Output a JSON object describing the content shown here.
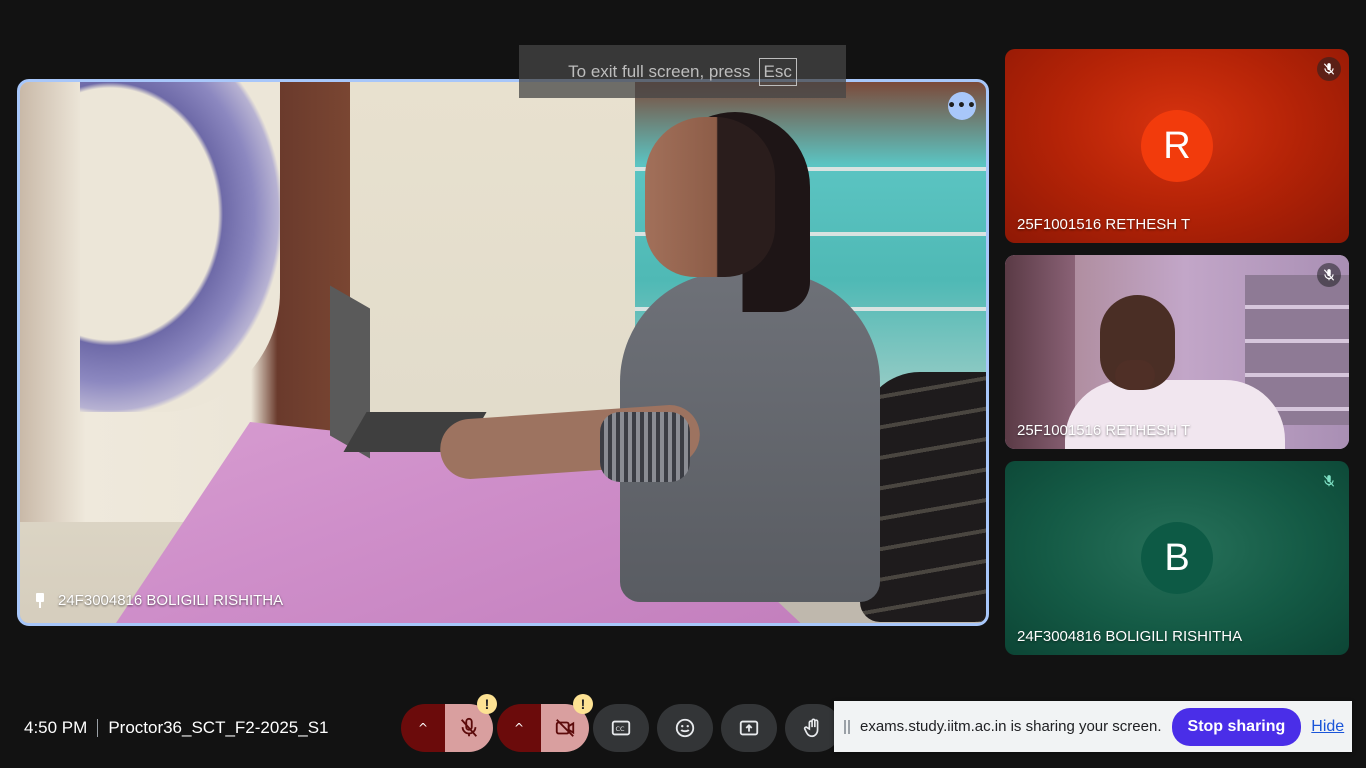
{
  "fullscreen_toast": {
    "text": "To exit full screen, press",
    "key": "Esc"
  },
  "main_tile": {
    "participant_name": "24F3004816 BOLIGILI RISHITHA",
    "pin_icon": "pin-icon",
    "more_icon": "more-options-icon"
  },
  "side_tiles": [
    {
      "name": "25F1001516 RETHESH T",
      "avatar_letter": "R",
      "avatar_color": "#f23b0c",
      "muted": true,
      "video": false
    },
    {
      "name": "25F1001516 RETHESH T",
      "muted": true,
      "video": true
    },
    {
      "name": "24F3004816 BOLIGILI RISHITHA",
      "avatar_letter": "B",
      "avatar_color": "#0d5a45",
      "muted": true,
      "video": false
    }
  ],
  "meeting": {
    "time": "4:50 PM",
    "code": "Proctor36_SCT_F2-2025_S1"
  },
  "controls": {
    "mic": {
      "state": "off",
      "warning": "!"
    },
    "camera": {
      "state": "off",
      "warning": "!"
    },
    "captions_icon": "captions-icon",
    "emoji_icon": "emoji-icon",
    "present_icon": "present-screen-icon",
    "raise_hand_icon": "raise-hand-icon"
  },
  "share_bar": {
    "text": "exams.study.iitm.ac.in is sharing your screen.",
    "stop_label": "Stop sharing",
    "hide_label": "Hide"
  },
  "colors": {
    "accent": "#a8c7fa",
    "stop_button": "#4a2ee8",
    "mic_off_red": "#6b0b0b"
  }
}
